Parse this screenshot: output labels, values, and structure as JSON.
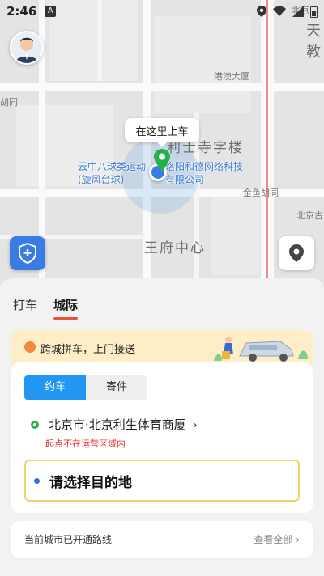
{
  "status_bar": {
    "time": "2:46",
    "notif_badge": "A"
  },
  "map": {
    "labels_big": [
      "天",
      "教",
      "王府中心",
      "利士寺字楼"
    ],
    "labels_small": [
      "北京",
      "港澳大厦",
      "胡同",
      "金鱼胡同",
      "北京古"
    ],
    "poi_left": [
      "云中八球类运动",
      "(旋风台球)"
    ],
    "poi_right": [
      "洛阳和德网络科技",
      "有限公司"
    ],
    "pickup_bubble": "在这里上车"
  },
  "sheet": {
    "tabs": [
      {
        "label": "打车",
        "active": false
      },
      {
        "label": "城际",
        "active": true
      }
    ],
    "promo_text": "跨城拼车，上门接送",
    "segment": [
      {
        "label": "约车",
        "active": true
      },
      {
        "label": "寄件",
        "active": false
      }
    ],
    "origin": "北京市·北京利生体育商厦",
    "origin_warning": "起点不在运营区域内",
    "destination_placeholder": "请选择目的地",
    "routes_label": "当前城市已开通路线",
    "routes_link": "查看全部"
  },
  "colors": {
    "accent_blue": "#2196f3",
    "tab_underline": "#e5533d",
    "warning": "#e5322d",
    "promo_bg": "#fdeec8",
    "origin_green": "#2ab34a"
  }
}
